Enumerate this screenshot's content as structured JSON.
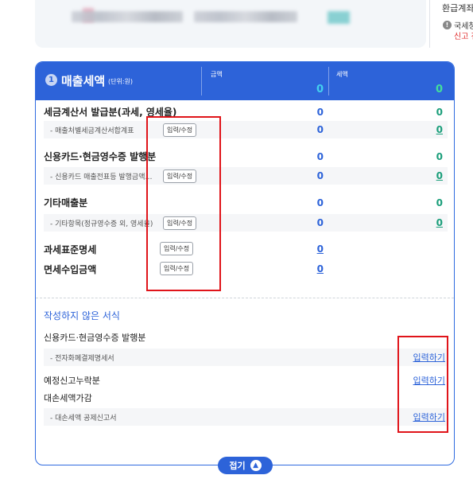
{
  "top": {
    "right_title": "환급계좌",
    "info_text": "국세청",
    "info_text_red": "신고 전"
  },
  "panel": {
    "badge": "1",
    "title": "매출세액",
    "unit": "(단위:원)",
    "col_amount_label": "금액",
    "col_tax_label": "세액",
    "total_amount": "0",
    "total_tax": "0"
  },
  "rows": {
    "tax_invoice": {
      "label": "세금계산서 발급분(과세, 영세율)",
      "amount": "0",
      "tax": "0",
      "sub_label": "- 매출처별세금계산서합계표",
      "sub_amount": "0",
      "sub_tax": "0",
      "edit_label": "입력/수정"
    },
    "card": {
      "label": "신용카드·현금영수증 발행분",
      "amount": "0",
      "tax": "0",
      "sub_label": "- 신용카드 매출전표등 발행금액…",
      "sub_amount": "0",
      "sub_tax": "0",
      "edit_label": "입력/수정"
    },
    "other": {
      "label": "기타매출분",
      "amount": "0",
      "tax": "0",
      "sub_label": "- 기타항목(정규영수증 외, 영세율)",
      "sub_amount": "0",
      "sub_tax": "0",
      "edit_label": "입력/수정"
    },
    "tax_base": {
      "label": "과세표준명세",
      "edit_label": "입력/수정",
      "amount": "0"
    },
    "exempt": {
      "label": "면세수입금액",
      "edit_label": "입력/수정",
      "amount": "0"
    }
  },
  "unwritten": {
    "title": "작성하지 않은 서식",
    "card_label": "신용카드·현금영수증 발행분",
    "card_sub_label": "- 전자화폐결제명세서",
    "card_link": "입력하기",
    "prelim_label": "예정신고누락분",
    "prelim_link": "입력하기",
    "bad_debt_label": "대손세액가감",
    "bad_debt_sub_label": "- 대손세액 공제신고서",
    "bad_debt_link": "입력하기"
  },
  "fold_button": {
    "label": "접기",
    "icon": "chevron-up-icon"
  },
  "colors": {
    "accent": "#2d63d9",
    "tax_value": "#1a9e7a",
    "highlight_box": "#e0141a"
  }
}
